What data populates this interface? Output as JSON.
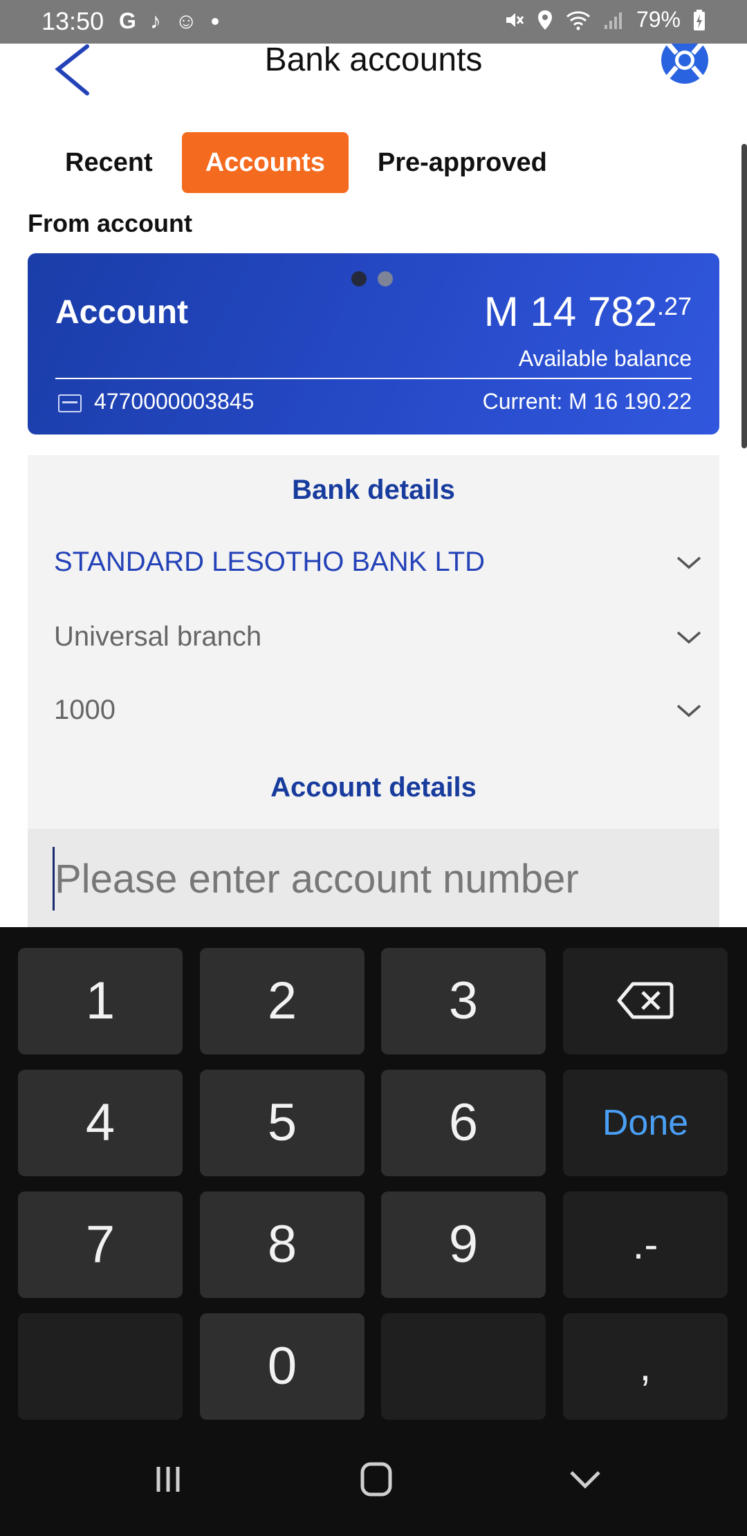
{
  "status_bar": {
    "time": "13:50",
    "app_icons": [
      "G",
      "♪",
      "☺",
      "•"
    ],
    "battery": "79%"
  },
  "header": {
    "title": "Bank accounts",
    "back_icon": "chevron-left-icon",
    "help_icon": "lifebuoy-icon",
    "accent_color": "#2442b8"
  },
  "tabs": [
    {
      "label": "Recent",
      "active": false
    },
    {
      "label": "Accounts",
      "active": true
    },
    {
      "label": "Pre-approved",
      "active": false
    }
  ],
  "tab_active_color": "#f46a1f",
  "from_account": {
    "label": "From account",
    "card": {
      "name": "Account",
      "balance_main": "M 14 782",
      "balance_cents": ".27",
      "balance_label": "Available balance",
      "account_number": "4770000003845",
      "current_balance": "Current: M 16 190.22",
      "page_count": 2,
      "active_page": 1
    }
  },
  "bank_details": {
    "title": "Bank details",
    "bank": "STANDARD LESOTHO BANK LTD",
    "branch": "Universal branch",
    "branch_code": "1000"
  },
  "account_details": {
    "title": "Account details",
    "account_number_placeholder": "Please enter account number",
    "account_number_value": ""
  },
  "keypad": {
    "keys": [
      "1",
      "2",
      "3",
      "4",
      "5",
      "6",
      "7",
      "8",
      "9",
      "0"
    ],
    "done_label": "Done",
    "symbol_label": ".-",
    "comma_label": ",",
    "backspace_icon": "backspace-icon"
  },
  "nav_bar": {
    "recents_icon": "recents-icon",
    "home_icon": "home-icon",
    "back_icon": "nav-back-icon"
  }
}
